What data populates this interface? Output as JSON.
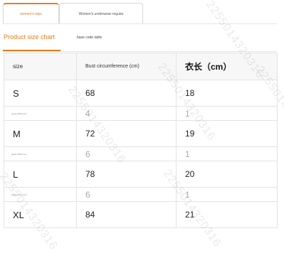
{
  "tabs": [
    {
      "label": "women's tops",
      "active": true
    },
    {
      "label": "Women's underwear-regular",
      "active": false
    }
  ],
  "subtabs": {
    "active_label": "Product size chart",
    "other_label": "base code table"
  },
  "table": {
    "headers": [
      "size",
      "Bust circumference (cm)",
      "衣长（cm）"
    ],
    "diff_label": "grade difference",
    "rows": [
      {
        "type": "size",
        "cells": [
          "S",
          "68",
          "18"
        ]
      },
      {
        "type": "diff",
        "cells": [
          "4",
          "1"
        ]
      },
      {
        "type": "size",
        "cells": [
          "M",
          "72",
          "19"
        ]
      },
      {
        "type": "diff",
        "cells": [
          "6",
          "1"
        ]
      },
      {
        "type": "size",
        "cells": [
          "L",
          "78",
          "20"
        ]
      },
      {
        "type": "diff",
        "cells": [
          "6",
          "1"
        ]
      },
      {
        "type": "size",
        "cells": [
          "XL",
          "84",
          "21"
        ]
      }
    ]
  },
  "watermark": "2255014320316",
  "colors": {
    "accent": "#e07f1f",
    "header_bg": "#f7f7f7",
    "border": "#e3e3e3",
    "diff_text": "#aaaaaa"
  }
}
